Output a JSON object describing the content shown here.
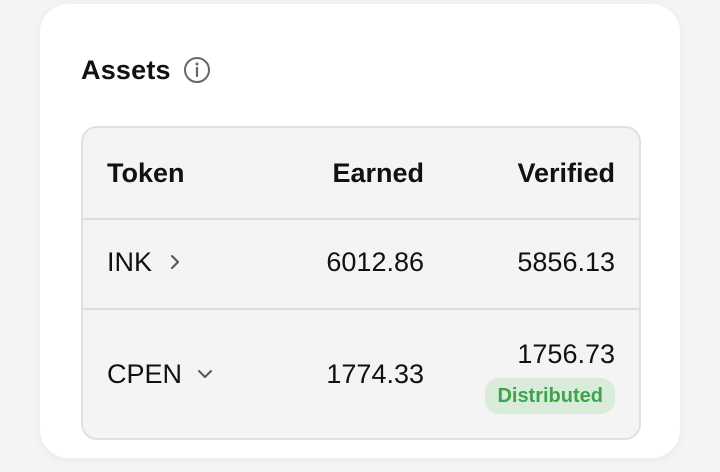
{
  "card": {
    "title": "Assets",
    "info_icon": "info-circle-icon"
  },
  "table": {
    "columns": [
      "Token",
      "Earned",
      "Verified"
    ],
    "rows": [
      {
        "token": "INK",
        "earned": "6012.86",
        "verified": "5856.13",
        "expander_icon": "chevron-right-icon"
      },
      {
        "token": "CPEN",
        "earned": "1774.33",
        "verified": "1756.73",
        "expander_icon": "chevron-down-icon",
        "status": "Distributed"
      }
    ]
  },
  "colors": {
    "badge_background": "#d8ecd9",
    "badge_text": "#3fa34d",
    "table_background": "#f4f4f4",
    "border": "#e0e0e0"
  }
}
